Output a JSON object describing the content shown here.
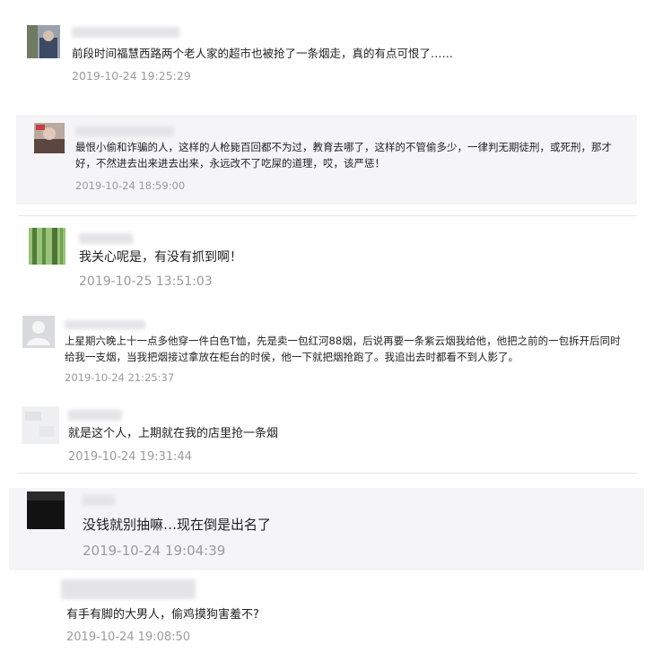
{
  "comments": [
    {
      "text": "前段时间福慧西路两个老人家的超市也被抢了一条烟走，真的有点可恨了……",
      "time": "2019-10-24 19:25:29"
    },
    {
      "text": "最恨小偷和诈骗的人，这样的人枪毙百回都不为过，教育去哪了，这样的不管偷多少，一律判无期徒刑，或死刑，那才好，不然进去出来进去出来，永远改不了吃屎的道理，哎，该严惩！",
      "time": "2019-10-24 18:59:00"
    },
    {
      "text": "我关心呢是，有没有抓到啊！",
      "time": "2019-10-25 13:51:03"
    },
    {
      "text": "上星期六晚上十一点多他穿一件白色T恤，先是卖一包红河88烟，后说再要一条紫云烟我给他，他把之前的一包拆开后同时给我一支烟，当我把烟接过拿放在柜台的时侯，他一下就把烟抢跑了。我追出去时都看不到人影了。",
      "time": "2019-10-24 21:25:37"
    },
    {
      "text": "就是这个人，上期就在我的店里抢一条烟",
      "time": "2019-10-24 19:31:44"
    },
    {
      "text": "没钱就别抽嘛…现在倒是出名了",
      "time": "2019-10-24 19:04:39"
    },
    {
      "text": "有手有脚的大男人，偷鸡摸狗害羞不?",
      "time": "2019-10-24 19:08:50"
    }
  ],
  "colors": {
    "text": "#222222",
    "time": "#9b9b9b",
    "shaded_bg": "#f5f5f7",
    "divider": "#e6e6ea"
  }
}
